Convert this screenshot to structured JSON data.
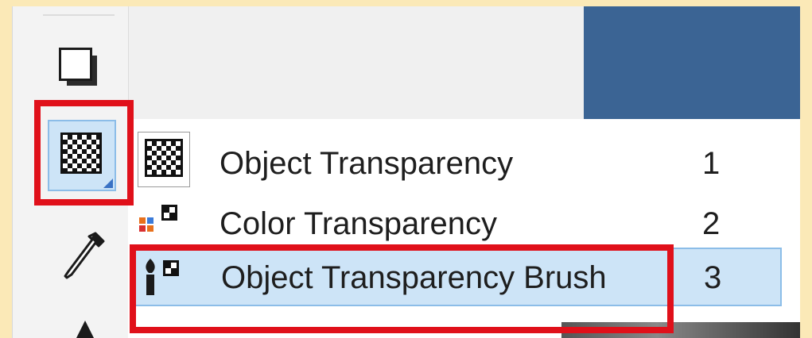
{
  "toolbox": {
    "tools": [
      {
        "icon": "drop-shadow-icon"
      },
      {
        "icon": "transparency-tool-icon",
        "selected": true
      },
      {
        "icon": "eyedropper-icon"
      },
      {
        "icon": "pen-icon"
      }
    ]
  },
  "flyout_menu": {
    "items": [
      {
        "label": "Object Transparency",
        "shortcut": "1",
        "icon": "object-transparency-icon"
      },
      {
        "label": "Color Transparency",
        "shortcut": "2",
        "icon": "color-transparency-icon"
      },
      {
        "label": "Object Transparency Brush",
        "shortcut": "3",
        "icon": "object-transparency-brush-icon",
        "hovered": true
      }
    ]
  },
  "colors": {
    "highlight": "#e0101a",
    "selection": "#cde4f7",
    "panel_blue": "#3b6494",
    "background": "#fbe9b7"
  }
}
